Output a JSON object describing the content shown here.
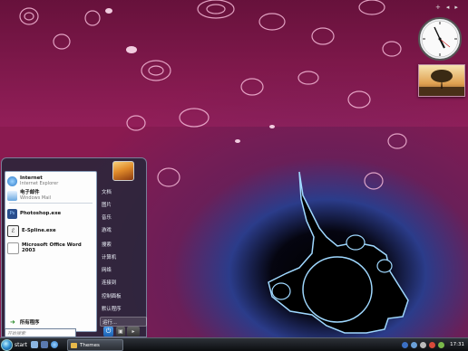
{
  "sidebar": {
    "controls": [
      "+",
      "◂",
      "▸"
    ]
  },
  "start_menu": {
    "pinned": [
      {
        "name": "Internet",
        "sub": "Internet Explorer",
        "icon": "ie-icon",
        "color": "#3b8ed8"
      },
      {
        "name": "电子邮件",
        "sub": "Windows Mail",
        "icon": "mail-icon",
        "color": "#5aa0d8"
      }
    ],
    "recent": [
      {
        "name": "Photoshop.exe",
        "icon": "photoshop-icon",
        "color": "#2a4e8c"
      },
      {
        "name": "E-Spline.exe",
        "icon": "espline-icon",
        "color": "#444444"
      },
      {
        "name": "Microsoft Office Word 2003",
        "icon": "document-icon",
        "color": "#dddddd"
      }
    ],
    "all_programs": "所有程序",
    "right_items": [
      "文档",
      "图片",
      "音乐",
      "游戏",
      "搜索",
      "计算机",
      "网络",
      "连接到",
      "控制面板",
      "默认程序",
      "运行..."
    ],
    "search_placeholder": "开始搜索"
  },
  "taskbar": {
    "start_label": "start",
    "task_label": "Themes",
    "clock": "17:31"
  },
  "colors": {
    "wallpaper_base": "#7a1848",
    "accent": "#2e8fd0"
  }
}
